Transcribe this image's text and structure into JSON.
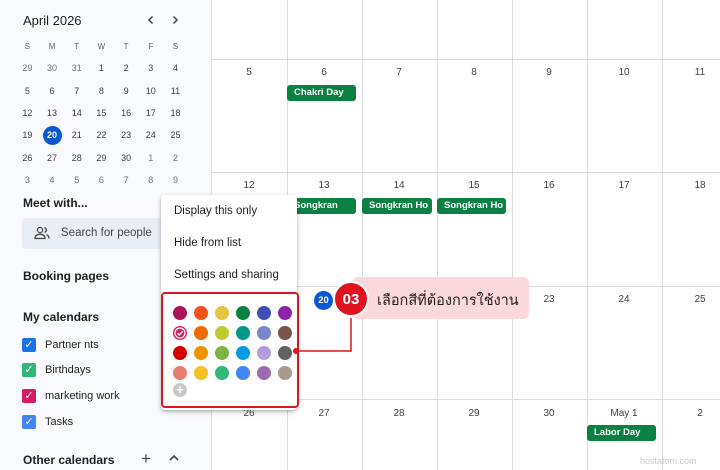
{
  "mini_calendar": {
    "title": "April 2026",
    "prev_label": "‹",
    "next_label": "›",
    "weekday_headers": [
      "S",
      "M",
      "T",
      "W",
      "T",
      "F",
      "S"
    ],
    "weeks": [
      [
        "29",
        "30",
        "31",
        "1",
        "2",
        "3",
        "4"
      ],
      [
        "5",
        "6",
        "7",
        "8",
        "9",
        "10",
        "11"
      ],
      [
        "12",
        "13",
        "14",
        "15",
        "16",
        "17",
        "18"
      ],
      [
        "19",
        "20",
        "21",
        "22",
        "23",
        "24",
        "25"
      ],
      [
        "26",
        "27",
        "28",
        "29",
        "30",
        "1",
        "2"
      ],
      [
        "3",
        "4",
        "5",
        "6",
        "7",
        "8",
        "9"
      ]
    ],
    "today": "20"
  },
  "sidebar": {
    "meet_title": "Meet with...",
    "search_people_placeholder": "Search for people",
    "booking_pages": "Booking pages",
    "my_calendars_title": "My calendars",
    "calendars": [
      {
        "label": "Partner nts",
        "color": "#1a73e8"
      },
      {
        "label": "Birthdays",
        "color": "#33b679"
      },
      {
        "label": "marketing work",
        "color": "#d81b60"
      },
      {
        "label": "Tasks",
        "color": "#4285f4"
      }
    ],
    "other_calendars_title": "Other calendars",
    "add_label": "+"
  },
  "calendar_grid": {
    "rows": [
      {
        "days": [
          "",
          "",
          "",
          "",
          "",
          "",
          ""
        ]
      },
      {
        "days": [
          "5",
          "6",
          "7",
          "8",
          "9",
          "10",
          "11"
        ]
      },
      {
        "days": [
          "12",
          "13",
          "14",
          "15",
          "16",
          "17",
          "18"
        ]
      },
      {
        "days": [
          "",
          "20",
          "",
          "",
          "23",
          "24",
          "25"
        ]
      },
      {
        "days": [
          "26",
          "27",
          "28",
          "29",
          "30",
          "May 1",
          "2"
        ]
      }
    ],
    "today_label": "20",
    "events": [
      {
        "label": "Chakri Day",
        "color": "#0b8043"
      },
      {
        "label": "Songkran",
        "color": "#0b8043"
      },
      {
        "label": "Songkran Ho",
        "color": "#0b8043"
      },
      {
        "label": "Songkran Ho",
        "color": "#0b8043"
      },
      {
        "label": "Labor Day",
        "color": "#0b8043"
      }
    ]
  },
  "context_menu": {
    "items": [
      "Display this only",
      "Hide from list",
      "Settings and sharing"
    ],
    "selected_color": "#ad1457",
    "color_palette": [
      [
        "#ad1457",
        "#f4511e",
        "#e4c441",
        "#0b8043",
        "#3f51b5",
        "#8e24aa"
      ],
      [
        "#d81b60",
        "#ef6c00",
        "#c0ca33",
        "#009688",
        "#7986cb",
        "#795548"
      ],
      [
        "#d50000",
        "#f09300",
        "#7cb342",
        "#039be5",
        "#b39ddb",
        "#616161"
      ],
      [
        "#e67c73",
        "#f6bf26",
        "#33b679",
        "#4285f4",
        "#9e69af",
        "#a79b8e"
      ]
    ],
    "add_color_label": "+"
  },
  "annotation": {
    "number": "03",
    "text": "เลือกสีที่ต้องการใช้งาน",
    "color": "#e0141e"
  },
  "watermark": "hostatom.com"
}
